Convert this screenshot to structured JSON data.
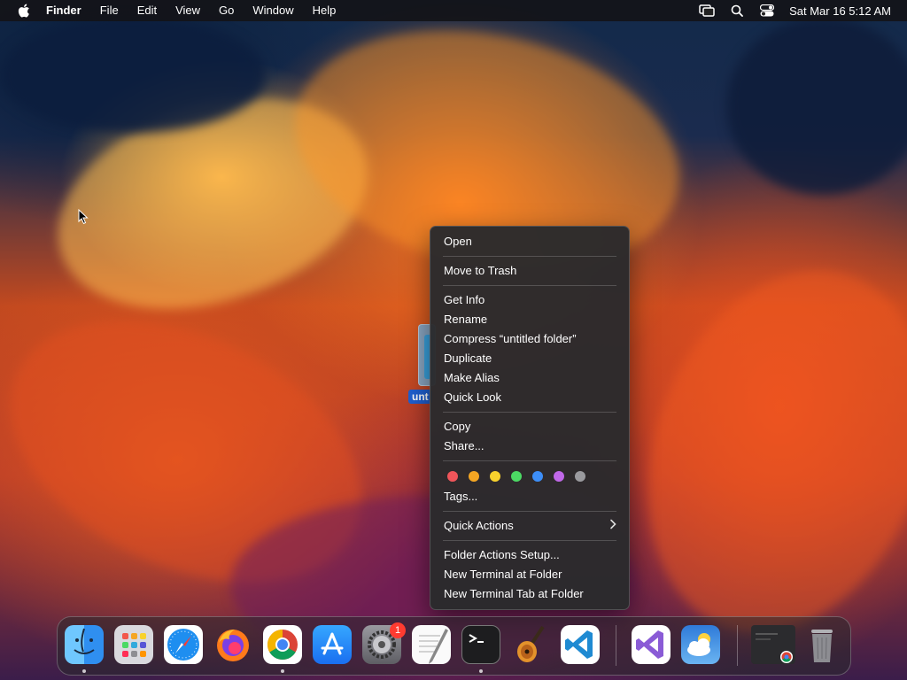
{
  "menubar": {
    "app_name": "Finder",
    "items": [
      "File",
      "Edit",
      "View",
      "Go",
      "Window",
      "Help"
    ],
    "clock": "Sat Mar 16  5:12 AM"
  },
  "desktop": {
    "folder_label": "unt"
  },
  "context_menu": {
    "open": "Open",
    "move_to_trash": "Move to Trash",
    "get_info": "Get Info",
    "rename": "Rename",
    "compress": "Compress “untitled folder”",
    "duplicate": "Duplicate",
    "make_alias": "Make Alias",
    "quick_look": "Quick Look",
    "copy": "Copy",
    "share": "Share...",
    "tags": "Tags...",
    "quick_actions": "Quick Actions",
    "folder_actions_setup": "Folder Actions Setup...",
    "new_terminal": "New Terminal at Folder",
    "new_terminal_tab": "New Terminal Tab at Folder",
    "tag_colors": [
      "#f0555a",
      "#f5a623",
      "#f8d22d",
      "#4cd964",
      "#3d8ef7",
      "#c068e8",
      "#9a9a9e"
    ]
  },
  "dock": {
    "system_settings_badge": "1"
  },
  "colors": {
    "menu_bg": "#2a2a2c",
    "accent": "#1f5fcf"
  }
}
